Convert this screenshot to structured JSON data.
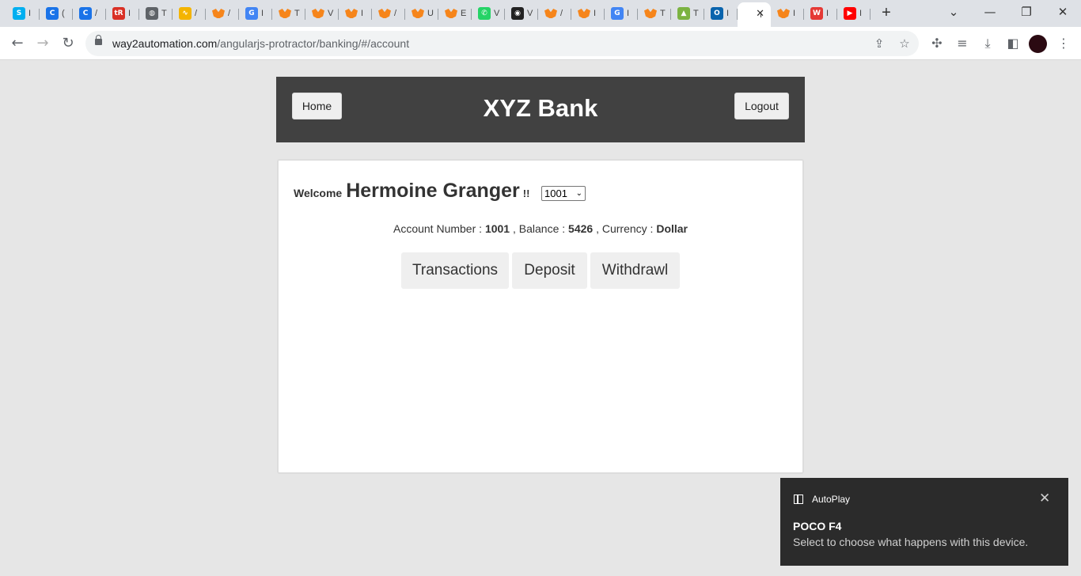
{
  "browser": {
    "tabs": [
      {
        "icon": "skype-icon",
        "glyph": "S",
        "color": "#00aff0",
        "title": "I"
      },
      {
        "icon": "chrome-c-icon",
        "glyph": "C",
        "color": "#1a73e8",
        "title": "("
      },
      {
        "icon": "chrome-c-icon",
        "glyph": "C",
        "color": "#1a73e8",
        "title": "/"
      },
      {
        "icon": "tr-icon",
        "glyph": "tR",
        "color": "#d93025",
        "title": "I"
      },
      {
        "icon": "globe-icon",
        "glyph": "◍",
        "color": "#5f6368",
        "title": "T"
      },
      {
        "icon": "chart-icon",
        "glyph": "∿",
        "color": "#f4b400",
        "title": "/"
      },
      {
        "icon": "metamask-icon",
        "glyph": "",
        "color": "#f6851b",
        "title": "/"
      },
      {
        "icon": "google-icon",
        "glyph": "G",
        "color": "#4285f4",
        "title": "I"
      },
      {
        "icon": "metamask-icon",
        "glyph": "",
        "color": "#f6851b",
        "title": "T"
      },
      {
        "icon": "metamask-icon",
        "glyph": "",
        "color": "#f6851b",
        "title": "V"
      },
      {
        "icon": "metamask-icon",
        "glyph": "",
        "color": "#f6851b",
        "title": "I"
      },
      {
        "icon": "metamask-icon",
        "glyph": "",
        "color": "#f6851b",
        "title": "/"
      },
      {
        "icon": "metamask-icon",
        "glyph": "",
        "color": "#f6851b",
        "title": "U"
      },
      {
        "icon": "metamask-icon",
        "glyph": "",
        "color": "#f6851b",
        "title": "E"
      },
      {
        "icon": "whatsapp-icon",
        "glyph": "✆",
        "color": "#25d366",
        "title": "V"
      },
      {
        "icon": "panda-icon",
        "glyph": "◉",
        "color": "#222222",
        "title": "V"
      },
      {
        "icon": "metamask-icon",
        "glyph": "",
        "color": "#f6851b",
        "title": "/"
      },
      {
        "icon": "metamask-icon",
        "glyph": "",
        "color": "#f6851b",
        "title": "I"
      },
      {
        "icon": "google-icon",
        "glyph": "G",
        "color": "#4285f4",
        "title": "I"
      },
      {
        "icon": "metamask-icon",
        "glyph": "",
        "color": "#f6851b",
        "title": "T"
      },
      {
        "icon": "android-icon",
        "glyph": "▲",
        "color": "#7cb342",
        "title": "T"
      },
      {
        "icon": "outlook-icon",
        "glyph": "O",
        "color": "#0a64ad",
        "title": "I"
      },
      {
        "icon": "page-icon",
        "glyph": "",
        "color": "#ffffff",
        "title": "I",
        "active": true
      },
      {
        "icon": "metamask-icon",
        "glyph": "",
        "color": "#f6851b",
        "title": "I"
      },
      {
        "icon": "w-icon",
        "glyph": "W",
        "color": "#e53935",
        "title": "I"
      },
      {
        "icon": "youtube-icon",
        "glyph": "▶",
        "color": "#ff0000",
        "title": "I"
      }
    ],
    "url_host": "way2automation.com",
    "url_path": "/angularjs-protractor/banking/#/account"
  },
  "header": {
    "home_label": "Home",
    "title": "XYZ Bank",
    "logout_label": "Logout"
  },
  "account": {
    "welcome": "Welcome",
    "customer_name": "Hermoine Granger",
    "exclaim": "!!",
    "selected_account": "1001",
    "account_number_label": "Account Number :",
    "account_number": "1001",
    "balance_label": ", Balance :",
    "balance": "5426",
    "currency_label": ", Currency :",
    "currency": "Dollar",
    "buttons": {
      "transactions": "Transactions",
      "deposit": "Deposit",
      "withdrawl": "Withdrawl"
    }
  },
  "toast": {
    "app": "AutoPlay",
    "title": "POCO F4",
    "message": "Select to choose what happens with this device."
  }
}
